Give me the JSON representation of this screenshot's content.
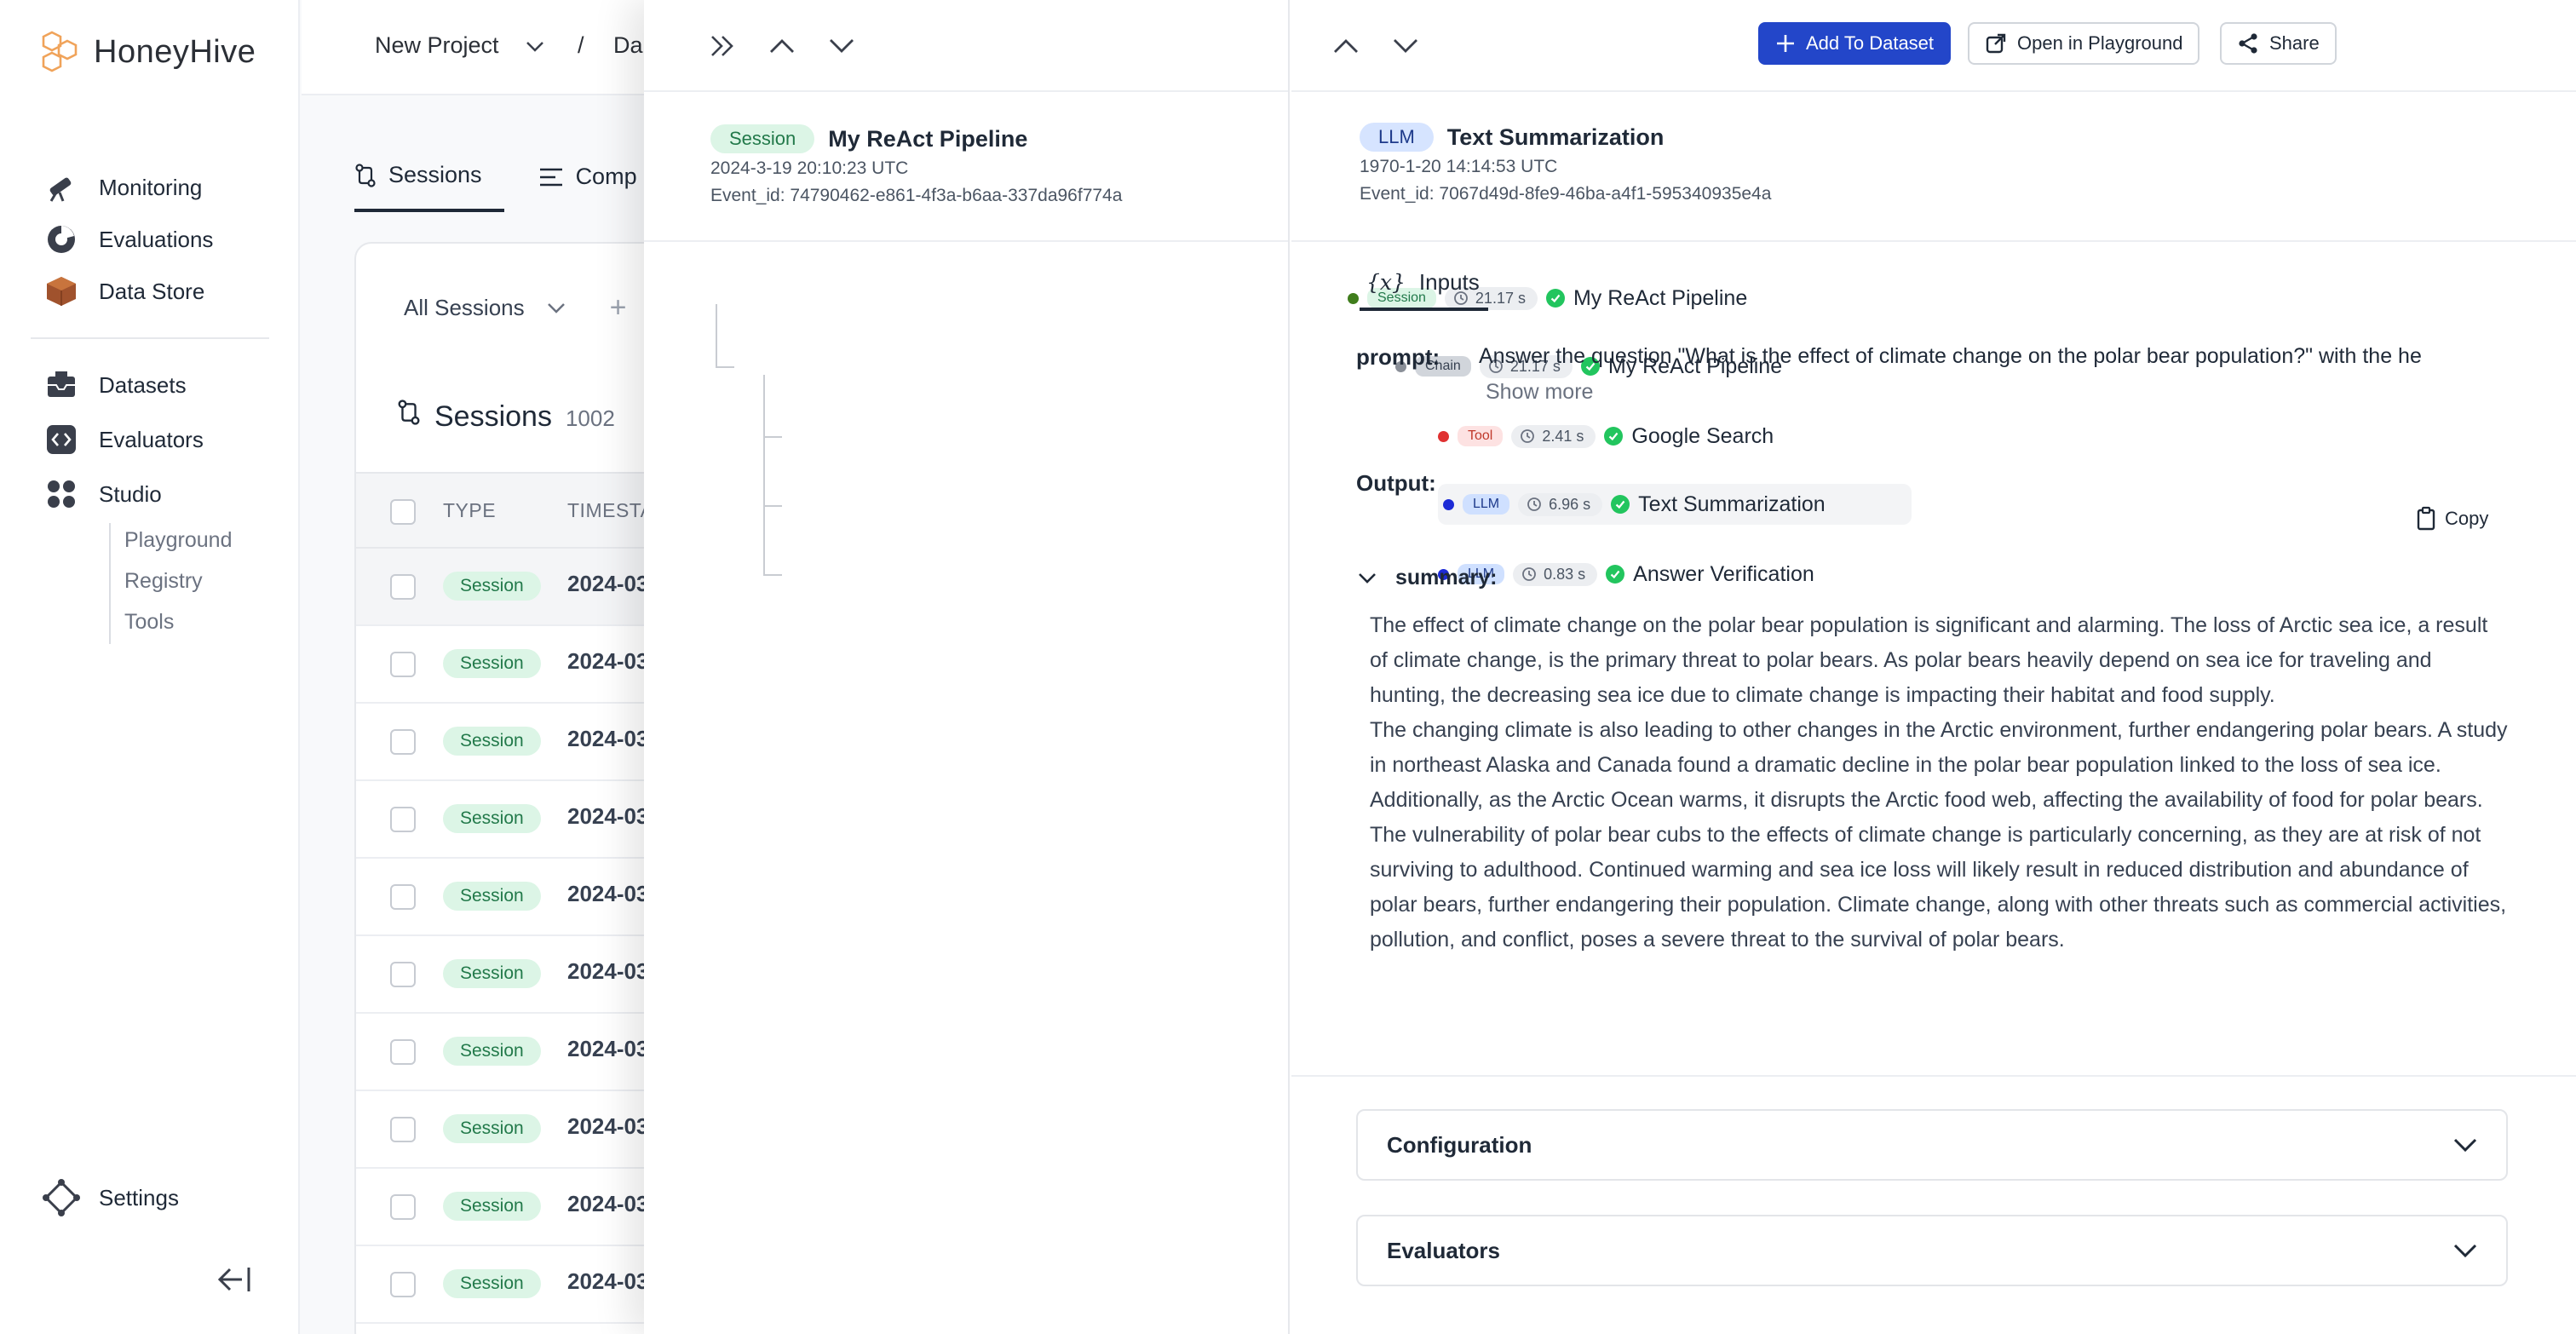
{
  "brand": {
    "name": "HoneyHive"
  },
  "sidebar": {
    "main": [
      {
        "label": "Monitoring",
        "icon": "telescope-icon"
      },
      {
        "label": "Evaluations",
        "icon": "pie-chart-icon"
      },
      {
        "label": "Data Store",
        "icon": "box-icon"
      }
    ],
    "secondary": [
      {
        "label": "Datasets",
        "icon": "inbox-icon"
      },
      {
        "label": "Evaluators",
        "icon": "code-icon"
      },
      {
        "label": "Studio",
        "icon": "grid-icon"
      }
    ],
    "studio_sub": [
      {
        "label": "Playground"
      },
      {
        "label": "Registry"
      },
      {
        "label": "Tools"
      }
    ],
    "settings_label": "Settings"
  },
  "topbar": {
    "project": "New Project",
    "separator": "/",
    "section_partial": "Da"
  },
  "sessions_page": {
    "tabs": [
      {
        "label": "Sessions"
      },
      {
        "label": "Comp"
      }
    ],
    "filter_label": "All Sessions",
    "add_symbol": "+",
    "title": "Sessions",
    "count": "1002",
    "columns": {
      "type": "TYPE",
      "timestamp": "TIMESTA"
    },
    "rows": [
      {
        "type": "Session",
        "timestamp": "2024-03"
      },
      {
        "type": "Session",
        "timestamp": "2024-03"
      },
      {
        "type": "Session",
        "timestamp": "2024-03"
      },
      {
        "type": "Session",
        "timestamp": "2024-03"
      },
      {
        "type": "Session",
        "timestamp": "2024-03"
      },
      {
        "type": "Session",
        "timestamp": "2024-03"
      },
      {
        "type": "Session",
        "timestamp": "2024-03"
      },
      {
        "type": "Session",
        "timestamp": "2024-03"
      },
      {
        "type": "Session",
        "timestamp": "2024-03"
      },
      {
        "type": "Session",
        "timestamp": "2024-03"
      }
    ]
  },
  "trace": {
    "header": {
      "type": "Session",
      "name": "My ReAct Pipeline",
      "time": "2024-3-19 20:10:23 UTC",
      "event_id": "Event_id: 74790462-e861-4f3a-b6aa-337da96f774a"
    },
    "nodes": [
      {
        "type": "Session",
        "duration": "21.17 s",
        "name": "My ReAct Pipeline",
        "dot_color": "#3f7d1c"
      },
      {
        "type": "Chain",
        "duration": "21.17 s",
        "name": "My ReAct Pipeline",
        "dot_color": "#8a8f98"
      },
      {
        "type": "Tool",
        "duration": "2.41 s",
        "name": "Google Search",
        "dot_color": "#e03131"
      },
      {
        "type": "LLM",
        "duration": "6.96 s",
        "name": "Text Summarization",
        "dot_color": "#1d2bd6"
      },
      {
        "type": "LLM",
        "duration": "0.83 s",
        "name": "Answer Verification",
        "dot_color": "#1d2bd6"
      }
    ]
  },
  "detail": {
    "buttons": {
      "add_to_dataset": "Add To Dataset",
      "open_playground": "Open in Playground",
      "share": "Share"
    },
    "header": {
      "type": "LLM",
      "name": "Text Summarization",
      "time": "1970-1-20 14:14:53 UTC",
      "event_id": "Event_id: 7067d49d-8fe9-46ba-a4f1-595340935e4a"
    },
    "inputs_tab": "Inputs",
    "inputs_icon_text": "{x}",
    "prompt_label": "prompt:",
    "prompt_value": "Answer the question \"What is the effect of climate change on the polar bear population?\" with the he",
    "show_more": "Show more",
    "output_label": "Output:",
    "copy_label": "Copy",
    "summary_label": "summary:",
    "summary_paragraphs": [
      "The effect of climate change on the polar bear population is significant and alarming. The loss of Arctic sea ice, a result of climate change, is the primary threat to polar bears. As polar bears heavily depend on sea ice for traveling and hunting, the decreasing sea ice due to climate change is impacting their habitat and food supply.",
      "The changing climate is also leading to other changes in the Arctic environment, further endangering polar bears. A study in northeast Alaska and Canada found a dramatic decline in the polar bear population linked to the loss of sea ice. Additionally, as the Arctic Ocean warms, it disrupts the Arctic food web, affecting the availability of food for polar bears.",
      "The vulnerability of polar bear cubs to the effects of climate change is particularly concerning, as they are at risk of not surviving to adulthood. Continued warming and sea ice loss will likely result in reduced distribution and abundance of polar bears, further endangering their population. Climate change, along with other threats such as commercial activities, pollution, and conflict, poses a severe threat to the survival of polar bears."
    ],
    "sections": [
      {
        "label": "Configuration"
      },
      {
        "label": "Evaluators"
      }
    ]
  },
  "colors": {
    "accent": "#2346c9",
    "success": "#22c55e",
    "session_bg": "#dcf5e6",
    "llm_bg": "#d6e4ff"
  }
}
